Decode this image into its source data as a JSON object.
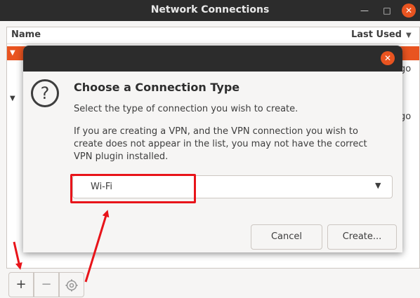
{
  "window": {
    "title": "Network Connections",
    "minimize_icon": "minimize-icon",
    "maximize_icon": "maximize-icon",
    "close_icon": "close-icon"
  },
  "list": {
    "columns": [
      "Name",
      "Last Used"
    ],
    "right_fragments": [
      "go",
      "go"
    ]
  },
  "toolbar": {
    "add_label": "+",
    "remove_label": "−",
    "settings_icon": "gear-icon"
  },
  "dialog": {
    "heading": "Choose a Connection Type",
    "subtitle": "Select the type of connection you wish to create.",
    "info": "If you are creating a VPN, and the VPN connection you wish to create does not appear in the list, you may not have the correct VPN plugin installed.",
    "selected_type": "Wi-Fi",
    "cancel_label": "Cancel",
    "create_label": "Create...",
    "icon": "question-icon"
  },
  "colors": {
    "accent": "#e95420",
    "annotation": "#e8141a",
    "titlebar": "#2c2c2c"
  }
}
